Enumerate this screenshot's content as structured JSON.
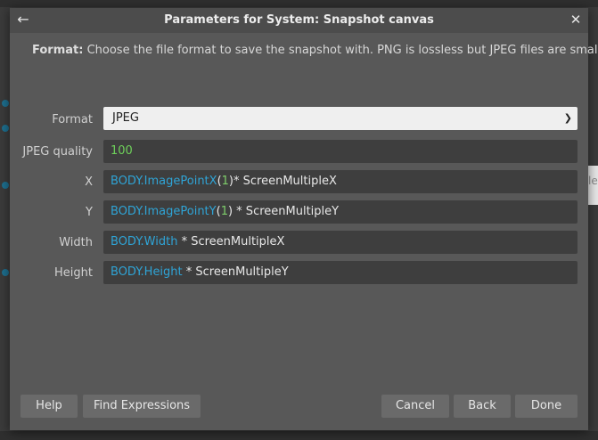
{
  "dialog": {
    "title": "Parameters for System: Snapshot canvas",
    "back_icon": "arrow-left-icon",
    "close_icon": "close-icon"
  },
  "description": {
    "bold": "Format:",
    "text": " Choose the file format to save the snapshot with. PNG is lossless but JPEG files are smaller."
  },
  "fields": {
    "format": {
      "label": "Format",
      "value": "JPEG"
    },
    "jpeg_quality": {
      "label": "JPEG quality",
      "value": "100"
    },
    "x": {
      "label": "X",
      "tokens": [
        "BODY",
        ".ImagePointX",
        "(",
        "1",
        ")",
        "* ScreenMultipleX"
      ]
    },
    "y": {
      "label": "Y",
      "tokens": [
        "BODY",
        ".ImagePointY",
        "(",
        "1",
        ")",
        " * ScreenMultipleY"
      ]
    },
    "width": {
      "label": "Width",
      "tokens": [
        "BODY",
        ".Width",
        " * ScreenMultipleX"
      ]
    },
    "height": {
      "label": "Height",
      "tokens": [
        "BODY",
        ".Height",
        " * ScreenMultipleY"
      ]
    }
  },
  "buttons": {
    "help": "Help",
    "find_expressions": "Find Expressions",
    "cancel": "Cancel",
    "back": "Back",
    "done": "Done"
  },
  "background": {
    "ghost_text": "le"
  },
  "colors": {
    "object_token": "#2fa4d6",
    "number_token": "#6ecf5a",
    "dialog_bg": "#585858"
  }
}
